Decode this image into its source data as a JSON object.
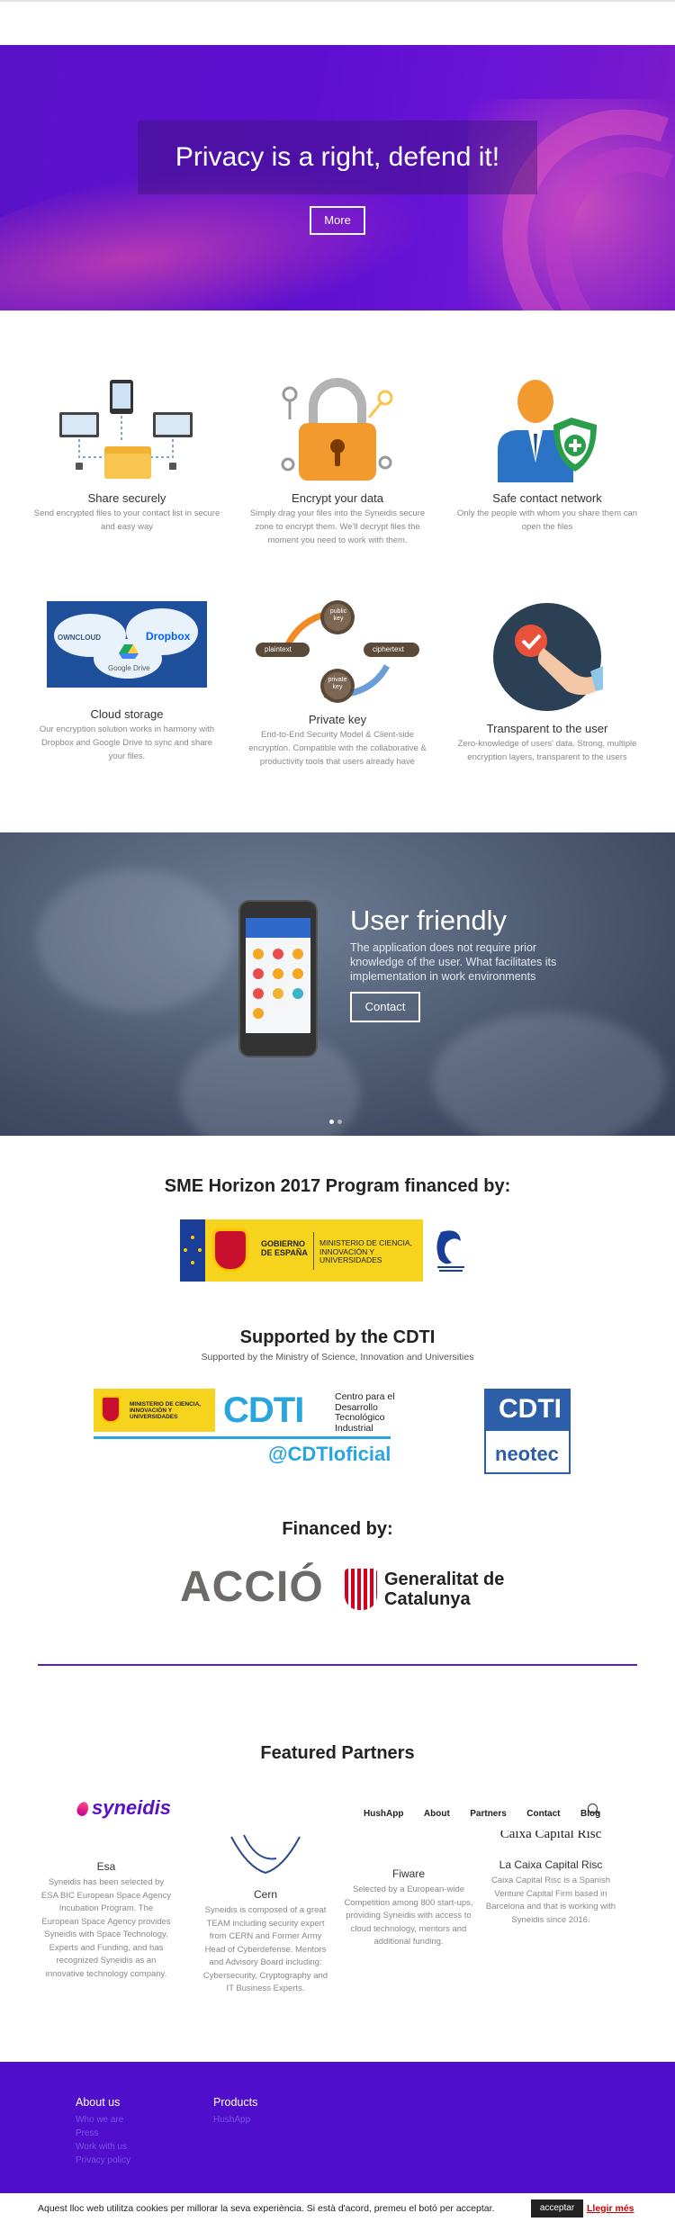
{
  "hero": {
    "title": "Privacy is a right, defend it!",
    "button": "More"
  },
  "features": [
    {
      "title": "Share securely",
      "text": "Send encrypted files to your contact list in secure and easy way"
    },
    {
      "title": "Encrypt your data",
      "text": "Simply drag your files into the Syneidis secure zone to encrypt them. We'll decrypt files the moment you need to work with them."
    },
    {
      "title": "Safe contact network",
      "text": "Only the people with whom you share them can open the files"
    },
    {
      "title": "Cloud storage",
      "text": "Our encryption solution works in harmony with Dropbox and Google Drive to sync and share your files."
    },
    {
      "title": "Private key",
      "text": "End-to-End Security Model & Client-side encryption. Compatible with the collaborative & productivity tools that users already have"
    },
    {
      "title": "Transparent to the user",
      "text": "Zero-knowledge of users' data. Strong, multiple encryption layers, transparent to the users"
    }
  ],
  "illustrations": {
    "cloud_owncloud": "OWNCLOUD",
    "cloud_dropbox": "Dropbox",
    "cloud_gdrive": "Google Drive",
    "key_public": "public key",
    "key_plaintext": "plaintext",
    "key_ciphertext": "ciphertext",
    "key_private": "private key"
  },
  "slider": {
    "title": "User friendly",
    "text": "The application does not require prior knowledge of the user. What facilitates its implementation in work environments",
    "button": "Contact"
  },
  "funding": {
    "sme_title": "SME Horizon 2017 Program financed by:",
    "gov_left": "GOBIERNO DE ESPAÑA",
    "gov_right": "MINISTERIO DE CIENCIA, INNOVACIÓN Y UNIVERSIDADES",
    "cdti_title": "Supported by the CDTI",
    "cdti_sub": "Supported by the Ministry of Science, Innovation and Universities",
    "cdti_ministry": "MINISTERIO DE CIENCIA, INNOVACIÓN Y UNIVERSIDADES",
    "cdti_mark": "CDTI",
    "cdti_desc": "Centro para el Desarrollo Tecnológico Industrial",
    "cdti_handle": "@CDTIoficial",
    "neotec_top": "CDTI",
    "neotec_bottom": "neotec",
    "financed_title": "Financed by:",
    "accio": "ACCIÓ",
    "gencat": "Generalitat de Catalunya"
  },
  "partners": {
    "title": "Featured Partners",
    "fiware_logo_hint": "",
    "caixa_logo": "Caixa Capital Risc",
    "items": [
      {
        "name": "Esa",
        "text": "Syneidis has been selected by ESA BIC European Space Agency Incubation Program. The European Space Agency provides Syneidis with Space Technology, Experts and Funding, and has recognized Syneidis as an innovative technology company."
      },
      {
        "name": "Cern",
        "text": "Syneidis is composed of a great TEAM including security expert from CERN and Former Army Head of Cyberdefense. Mentors and Advisory Board including: Cybersecurity, Cryptography and IT Business Experts."
      },
      {
        "name": "Fiware",
        "text": "Selected by a European-wide Competition among 800 start-ups, providing Syneidis with access to cloud technology, mentors and additional funding."
      },
      {
        "name": "La Caixa Capital Risc",
        "text": "Caixa Capital Risc is a Spanish Venture Capital Firm based in Barcelona and that is working with Syneidis since 2016."
      }
    ]
  },
  "header": {
    "logo": "syneidis",
    "nav": [
      "HushApp",
      "About",
      "Partners",
      "Contact",
      "Blog"
    ]
  },
  "footer": {
    "about_title": "About us",
    "about_links": [
      "Who we are",
      "Press",
      "Work with us",
      "Privacy policy"
    ],
    "products_title": "Products",
    "products_links": [
      "HushApp"
    ]
  },
  "cookie": {
    "text": "Aquest lloc web utilitza cookies per millorar la seva experiència. Si està d'acord, premeu el botó per acceptar.",
    "accept": "acceptar",
    "more": "Llegir més"
  },
  "colors": {
    "brand_purple": "#5a12c8",
    "footer_purple": "#4f0dcc",
    "cdti_blue": "#2aa5de"
  }
}
